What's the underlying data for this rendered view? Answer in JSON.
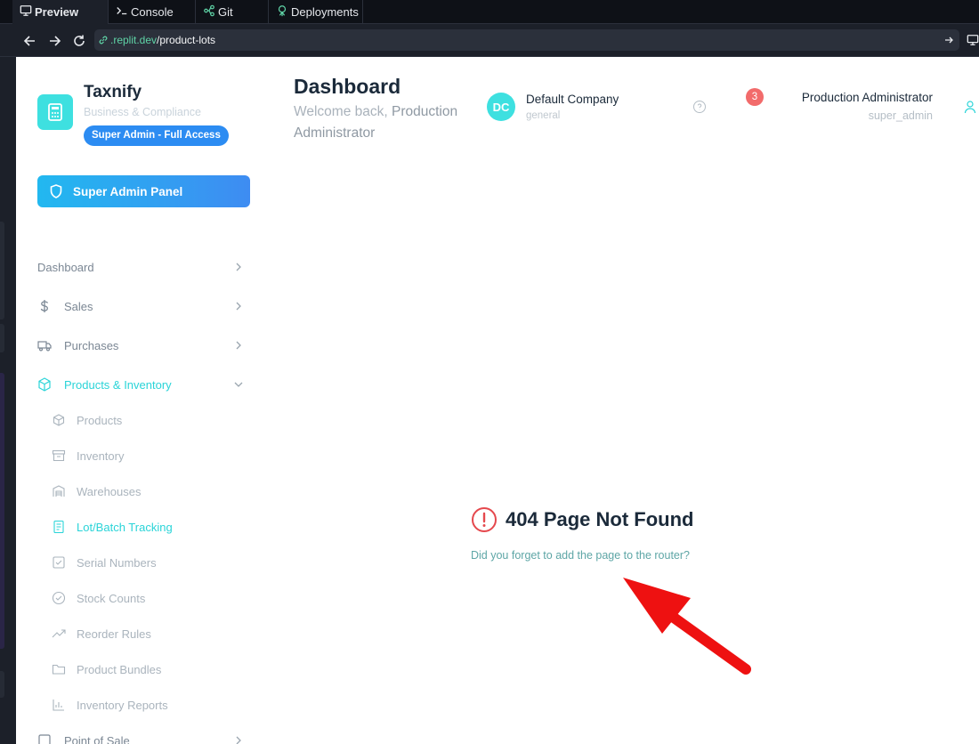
{
  "ide": {
    "tabs": [
      {
        "label": "Preview",
        "icon": "monitor-icon"
      },
      {
        "label": "Console",
        "icon": "terminal-icon"
      },
      {
        "label": "Git",
        "icon": "git-branch-icon"
      },
      {
        "label": "Deployments",
        "icon": "deploy-icon"
      }
    ],
    "url_host": ".replit.dev",
    "url_path": "/product-lots"
  },
  "brand": {
    "name": "Taxnify",
    "subtitle": "Business & Compliance",
    "role_badge": "Super Admin - Full Access"
  },
  "admin_panel_label": "Super Admin Panel",
  "nav": {
    "dashboard": "Dashboard",
    "sales": "Sales",
    "purchases": "Purchases",
    "products_inventory": "Products & Inventory",
    "point_of_sale": "Point of Sale"
  },
  "subnav": [
    {
      "label": "Products",
      "icon": "box-icon"
    },
    {
      "label": "Inventory",
      "icon": "archive-icon"
    },
    {
      "label": "Warehouses",
      "icon": "warehouse-icon"
    },
    {
      "label": "Lot/Batch Tracking",
      "icon": "file-list-icon"
    },
    {
      "label": "Serial Numbers",
      "icon": "check-square-icon"
    },
    {
      "label": "Stock Counts",
      "icon": "check-circle-icon"
    },
    {
      "label": "Reorder Rules",
      "icon": "trending-up-icon"
    },
    {
      "label": "Product Bundles",
      "icon": "folder-icon"
    },
    {
      "label": "Inventory Reports",
      "icon": "bar-chart-icon"
    }
  ],
  "header": {
    "title": "Dashboard",
    "welcome_prefix": "Welcome back,",
    "welcome_name": "Production Administrator",
    "company_initials": "DC",
    "company_name": "Default Company",
    "company_type": "general",
    "notification_count": "3",
    "user_name": "Production Administrator",
    "user_role": "super_admin"
  },
  "not_found": {
    "title": "404 Page Not Found",
    "message": "Did you forget to add the page to the router?"
  },
  "colors": {
    "accent": "#2ad4d8",
    "primary_blue": "#3e8cf2",
    "error_red": "#e5484d",
    "annotation_red": "#ee1111"
  }
}
